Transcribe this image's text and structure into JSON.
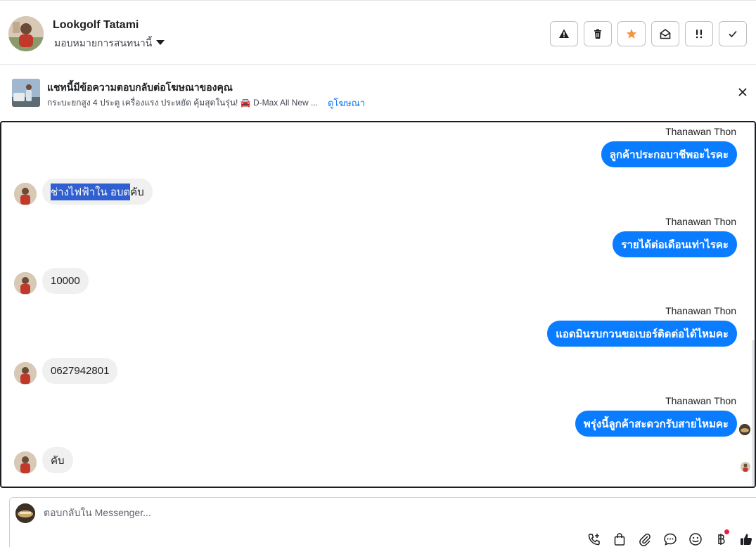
{
  "header": {
    "contact_name": "Lookgolf Tatami",
    "assign_label": "มอบหมายการสนทนานี้",
    "actions": [
      {
        "name": "report-spam-button",
        "icon": "warning-icon"
      },
      {
        "name": "delete-button",
        "icon": "trash-icon"
      },
      {
        "name": "star-button",
        "icon": "star-icon",
        "color": "#f7923b"
      },
      {
        "name": "mark-unread-button",
        "icon": "envelope-open-icon"
      },
      {
        "name": "follow-up-button",
        "icon": "double-exclamation-icon"
      },
      {
        "name": "mark-done-button",
        "icon": "check-icon"
      }
    ]
  },
  "ad": {
    "title": "แชทนี้มีข้อความตอบกลับต่อโฆษณาของคุณ",
    "subtitle": "กระบะยกสูง 4 ประตู เครื่องแรง ประหยัด คุ้มสุดในรุ่น! 🚘 D-Max All New ...",
    "link": "ดูโฆษณา"
  },
  "messages": {
    "m1_sender": "Thanawan Thon",
    "m1_text": "ลูกค้าประกอบาชีพอะไรคะ",
    "m2_highlight": "ช่างไฟฟ้าใน อบต",
    "m2_rest": " คับ",
    "m3_sender": "Thanawan Thon",
    "m3_text": "รายได้ต่อเดือนเท่าไรคะ",
    "m4_text": "10000",
    "m5_sender": "Thanawan Thon",
    "m5_text": "แอดมินรบกวนขอเบอร์ติดต่อได้ไหมคะ",
    "m6_text": "0627942801",
    "m7_sender": "Thanawan Thon",
    "m7_text": "พรุ่งนี้ลูกค้าสะดวกรับสายไหมคะ",
    "m8_text": "คับ"
  },
  "composer": {
    "placeholder": "ตอบกลับใน Messenger...",
    "tools": [
      "call-add-icon",
      "shopping-bag-icon",
      "paperclip-icon",
      "speech-bubble-icon",
      "smiley-icon",
      "baht-icon",
      "thumbs-up-icon"
    ],
    "notification_color": "#e41e3f"
  },
  "colors": {
    "outgoing_bubble": "#0a7cff",
    "incoming_bubble": "#f0f0f0",
    "selection_highlight": "#2f5fd0",
    "link": "#1877f2"
  }
}
